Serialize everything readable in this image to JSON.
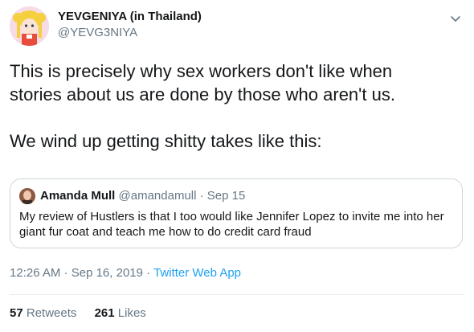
{
  "author": {
    "display_name": "YEVGENIYA (in Thailand)",
    "handle": "@YEVG3NIYA",
    "avatar_icon": "cartoon-avatar-icon"
  },
  "tweet": {
    "line1": "This is precisely why sex workers don't like when",
    "line2": "stories about us are done by those who aren't us.",
    "line3": "We wind up getting shitty takes like this:"
  },
  "quoted": {
    "name": "Amanda Mull",
    "handle": "@amandamull",
    "separator": "·",
    "date": "Sep 15",
    "text_line1": "My review of Hustlers is that I too would like Jennifer Lopez to invite me into her",
    "text_line2": "giant fur coat and teach me how to do credit card fraud"
  },
  "meta": {
    "time": "12:26 AM",
    "separator": "·",
    "date": "Sep 16, 2019",
    "separator2": "·",
    "app": "Twitter Web App"
  },
  "stats": {
    "retweets_count": "57",
    "retweets_label": "Retweets",
    "likes_count": "261",
    "likes_label": "Likes"
  },
  "colors": {
    "link": "#1da1f2",
    "secondary_text": "#657786",
    "border": "#ccd6dd"
  }
}
